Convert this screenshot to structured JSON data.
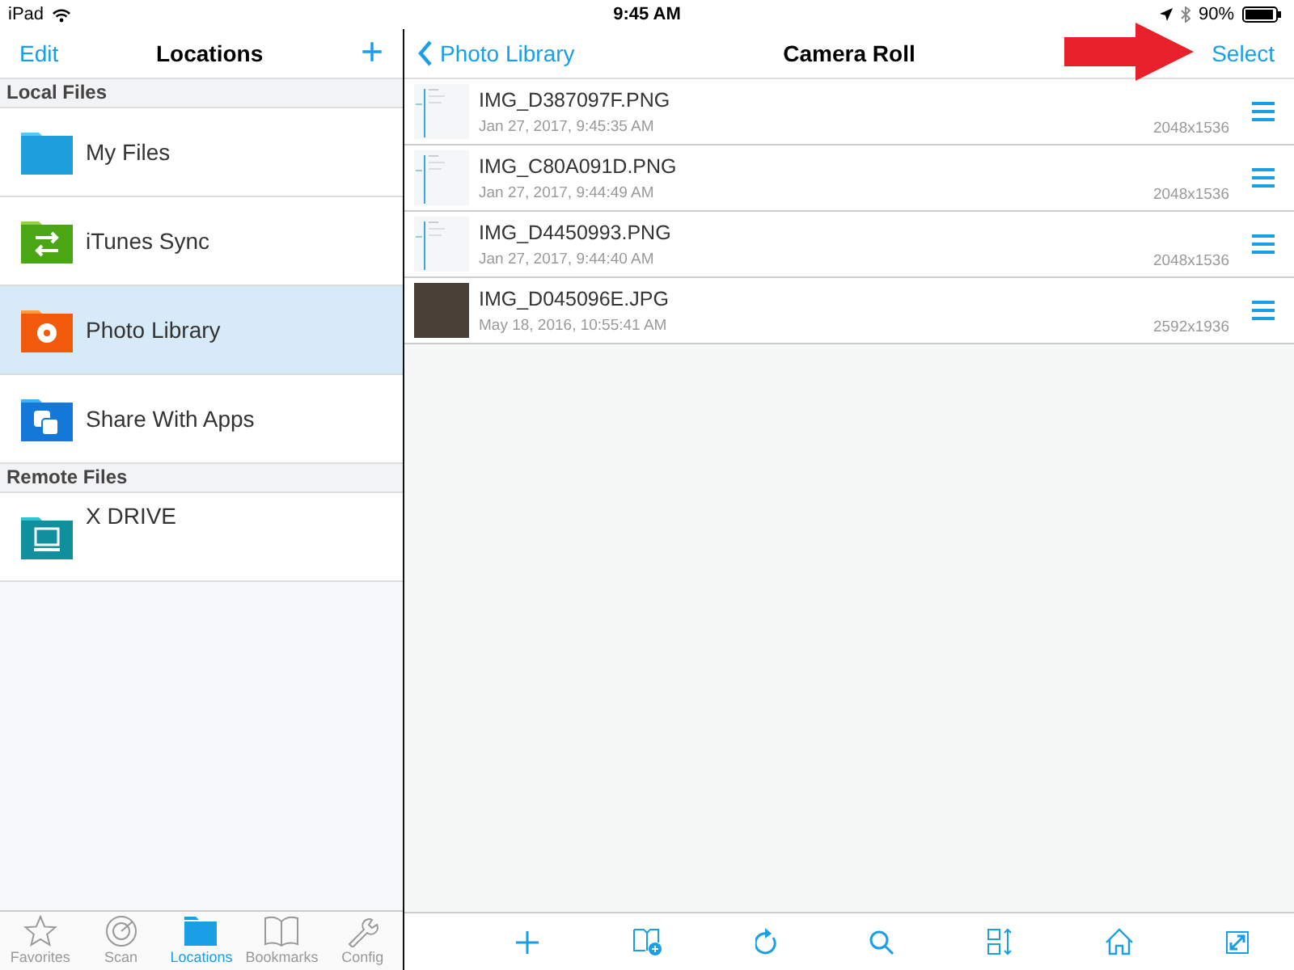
{
  "status_bar": {
    "device": "iPad",
    "time": "9:45 AM",
    "battery": "90%"
  },
  "left_nav": {
    "edit": "Edit",
    "title": "Locations",
    "add": "+"
  },
  "sections": [
    {
      "title": "Local Files",
      "items": [
        {
          "label": "My Files",
          "kind": "plain",
          "selected": false
        },
        {
          "label": "iTunes Sync",
          "kind": "sync",
          "selected": false
        },
        {
          "label": "Photo Library",
          "kind": "photo",
          "selected": true
        },
        {
          "label": "Share With Apps",
          "kind": "share",
          "selected": false
        }
      ]
    },
    {
      "title": "Remote Files",
      "items": [
        {
          "label": "X DRIVE",
          "kind": "computer",
          "selected": false
        }
      ]
    }
  ],
  "right_nav": {
    "back": "Photo Library",
    "title": "Camera Roll",
    "select": "Select"
  },
  "files": [
    {
      "name": "IMG_D387097F.PNG",
      "date": "Jan 27, 2017, 9:45:35 AM",
      "size": "2048x1536",
      "kind": "screenshot"
    },
    {
      "name": "IMG_C80A091D.PNG",
      "date": "Jan 27, 2017, 9:44:49 AM",
      "size": "2048x1536",
      "kind": "screenshot"
    },
    {
      "name": "IMG_D4450993.PNG",
      "date": "Jan 27, 2017, 9:44:40 AM",
      "size": "2048x1536",
      "kind": "screenshot"
    },
    {
      "name": "IMG_D045096E.JPG",
      "date": "May 18, 2016, 10:55:41 AM",
      "size": "2592x1936",
      "kind": "photo"
    }
  ],
  "tabs": [
    {
      "label": "Favorites",
      "selected": false
    },
    {
      "label": "Scan",
      "selected": false
    },
    {
      "label": "Locations",
      "selected": true
    },
    {
      "label": "Bookmarks",
      "selected": false
    },
    {
      "label": "Config",
      "selected": false
    }
  ]
}
